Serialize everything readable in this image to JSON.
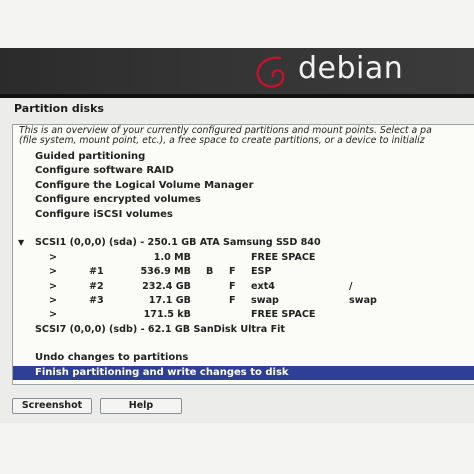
{
  "header": {
    "logo_text": "debian"
  },
  "page_title": "Partition disks",
  "description": [
    "This is an overview of your currently configured partitions and mount points. Select a pa",
    "(file system, mount point, etc.), a free space to create partitions, or a device to initializ"
  ],
  "menu": {
    "guided": "Guided partitioning",
    "raid": "Configure software RAID",
    "lvm": "Configure the Logical Volume Manager",
    "encrypted": "Configure encrypted volumes",
    "iscsi": "Configure iSCSI volumes"
  },
  "disk1": {
    "toggle": "▼",
    "label": "SCSI1 (0,0,0) (sda) - 250.1 GB ATA Samsung SSD 840"
  },
  "partitions": [
    {
      "arrow": ">",
      "num": "",
      "size": "1.0 MB",
      "b": "",
      "f": "",
      "type": "FREE SPACE",
      "mount": ""
    },
    {
      "arrow": ">",
      "num": "#1",
      "size": "536.9 MB",
      "b": "B",
      "f": "F",
      "type": "ESP",
      "mount": ""
    },
    {
      "arrow": ">",
      "num": "#2",
      "size": "232.4 GB",
      "b": "",
      "f": "F",
      "type": "ext4",
      "mount": "/"
    },
    {
      "arrow": ">",
      "num": "#3",
      "size": "17.1 GB",
      "b": "",
      "f": "F",
      "type": "swap",
      "mount": "swap"
    },
    {
      "arrow": ">",
      "num": "",
      "size": "171.5 kB",
      "b": "",
      "f": "",
      "type": "FREE SPACE",
      "mount": ""
    }
  ],
  "disk2": {
    "label": "SCSI7 (0,0,0) (sdb) - 62.1 GB SanDisk Ultra Fit"
  },
  "actions": {
    "undo": "Undo changes to partitions",
    "finish": "Finish partitioning and write changes to disk"
  },
  "buttons": {
    "screenshot": "Screenshot",
    "help": "Help"
  },
  "colors": {
    "selection": "#2f3f95",
    "header_bg": "#333333",
    "logo_swirl": "#c8102e"
  }
}
